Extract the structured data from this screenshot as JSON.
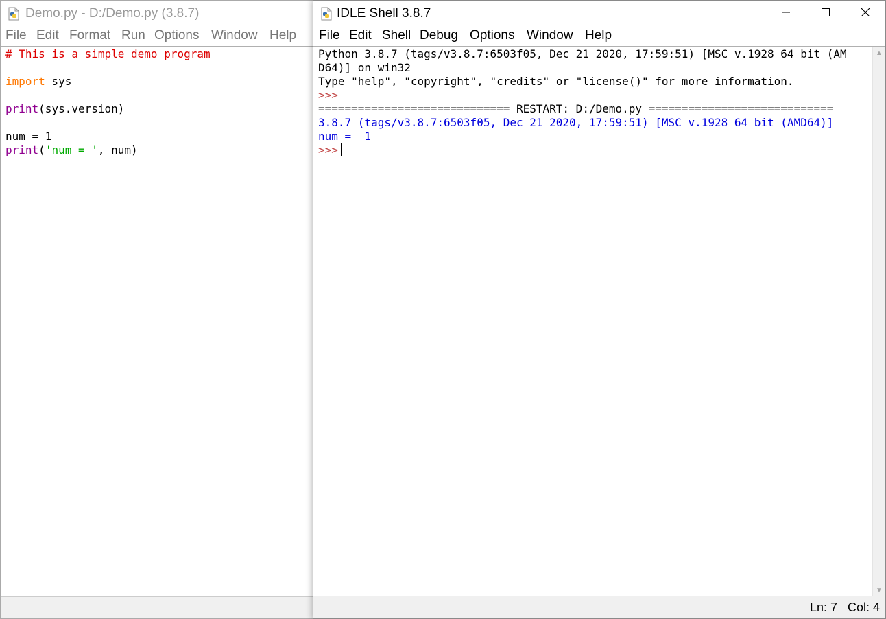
{
  "editor": {
    "title": "Demo.py - D:/Demo.py (3.8.7)",
    "menu": [
      "File",
      "Edit",
      "Format",
      "Run",
      "Options",
      "Window",
      "Help"
    ],
    "code": {
      "line1": "# This is a simple demo program",
      "line3_kw": "import",
      "line3_rest": " sys",
      "line5_fn": "print",
      "line5_rest": "(sys.version)",
      "line7": "num = 1",
      "line8_fn": "print",
      "line8_paren": "(",
      "line8_str": "'num = '",
      "line8_rest": ", num)"
    },
    "icon": "python-file-icon"
  },
  "shell": {
    "title": "IDLE Shell 3.8.7",
    "menu": [
      "File",
      "Edit",
      "Shell",
      "Debug",
      "Options",
      "Window",
      "Help"
    ],
    "lines": {
      "banner1": "Python 3.8.7 (tags/v3.8.7:6503f05, Dec 21 2020, 17:59:51) [MSC v.1928 64 bit (AM",
      "banner2": "D64)] on win32",
      "banner3": "Type \"help\", \"copyright\", \"credits\" or \"license()\" for more information.",
      "prompt1": ">>>",
      "restart": "============================= RESTART: D:/Demo.py ============================",
      "out1": "3.8.7 (tags/v3.8.7:6503f05, Dec 21 2020, 17:59:51) [MSC v.1928 64 bit (AMD64)]",
      "out2": "num =  1",
      "prompt2": ">>>"
    },
    "status": "Ln: 7   Col: 4",
    "icon": "python-file-icon"
  },
  "colors": {
    "comment": "#dd0000",
    "keyword": "#ff7700",
    "builtin": "#900090",
    "string": "#00aa00",
    "prompt": "#c04040",
    "output": "#0000dd"
  }
}
